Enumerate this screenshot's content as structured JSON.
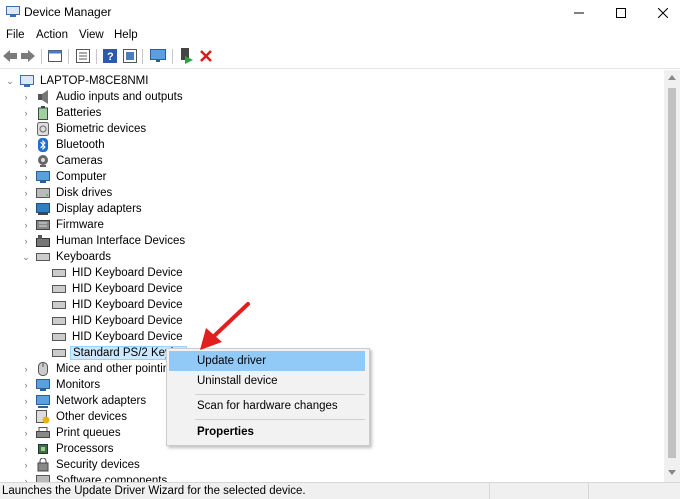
{
  "window": {
    "title": "Device Manager",
    "minimize_label": "—",
    "maximize_label": "☐",
    "close_label": "✕"
  },
  "menu": [
    "File",
    "Action",
    "View",
    "Help"
  ],
  "toolbar": {
    "icons": [
      "back-icon",
      "forward-icon",
      "properties-icon",
      "show-hide-icon",
      "help-icon",
      "update-driver-icon",
      "scan-hardware-icon",
      "enable-device-icon",
      "uninstall-device-icon"
    ],
    "uninstall_color": "#d81e1e"
  },
  "tree": {
    "root": "LAPTOP-M8CE8NMI",
    "categories": [
      "Audio inputs and outputs",
      "Batteries",
      "Biometric devices",
      "Bluetooth",
      "Cameras",
      "Computer",
      "Disk drives",
      "Display adapters",
      "Firmware",
      "Human Interface Devices",
      "Keyboards"
    ],
    "keyboard_children": [
      "HID Keyboard Device",
      "HID Keyboard Device",
      "HID Keyboard Device",
      "HID Keyboard Device",
      "HID Keyboard Device",
      "Standard PS/2 Keybo"
    ],
    "categories_after": [
      "Mice and other pointing",
      "Monitors",
      "Network adapters",
      "Other devices",
      "Print queues",
      "Processors",
      "Security devices",
      "Software components"
    ]
  },
  "context_menu": {
    "update_driver": "Update driver",
    "uninstall_device": "Uninstall device",
    "scan_hardware": "Scan for hardware changes",
    "properties": "Properties"
  },
  "status": {
    "text": "Launches the Update Driver Wizard for the selected device."
  },
  "colors": {
    "selection": "#cce8ff",
    "menu_highlight": "#91c9f7",
    "arrow": "#e02020"
  }
}
